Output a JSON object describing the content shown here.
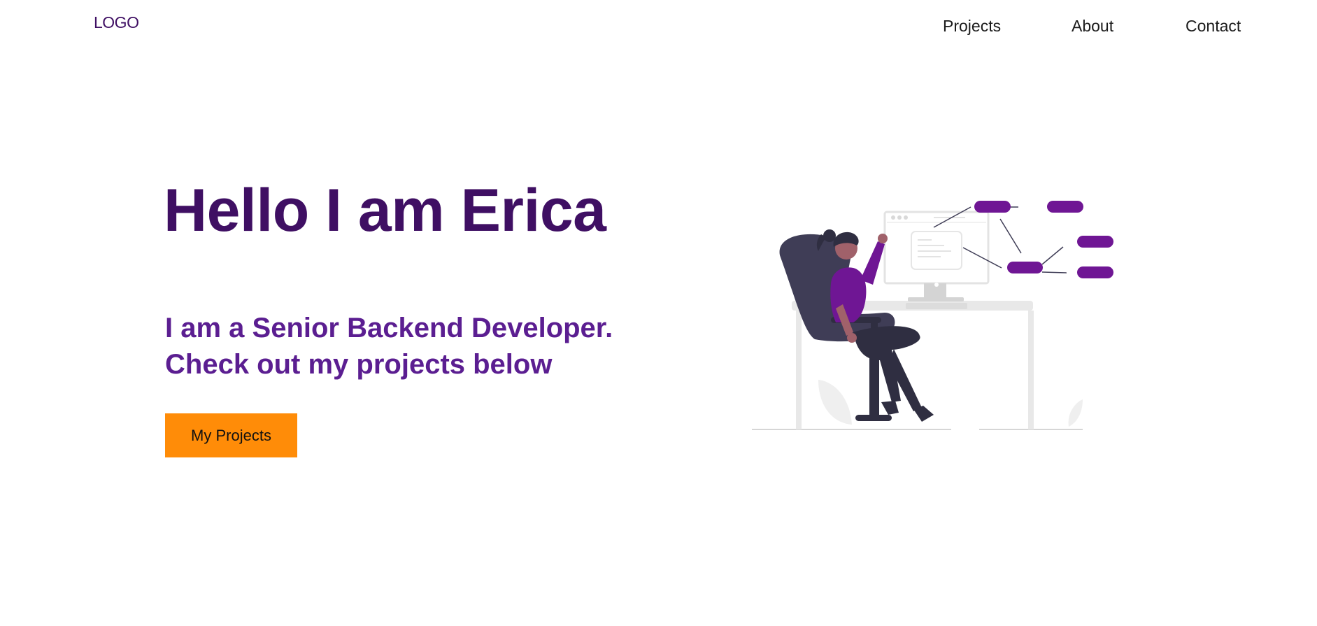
{
  "header": {
    "logo": "LOGO",
    "nav": [
      {
        "label": "Projects"
      },
      {
        "label": "About"
      },
      {
        "label": "Contact"
      }
    ]
  },
  "hero": {
    "title": "Hello I am Erica",
    "subtitle_line1": "I am a Senior Backend Developer.",
    "subtitle_line2": "Check out my projects below",
    "cta_label": "My Projects"
  },
  "illustration": {
    "icon": "developer-at-desk-illustration"
  },
  "colors": {
    "brand_dark": "#3f0f63",
    "brand_purple": "#5b1e91",
    "accent_purple": "#6f1694",
    "cta": "#ff8c08"
  }
}
